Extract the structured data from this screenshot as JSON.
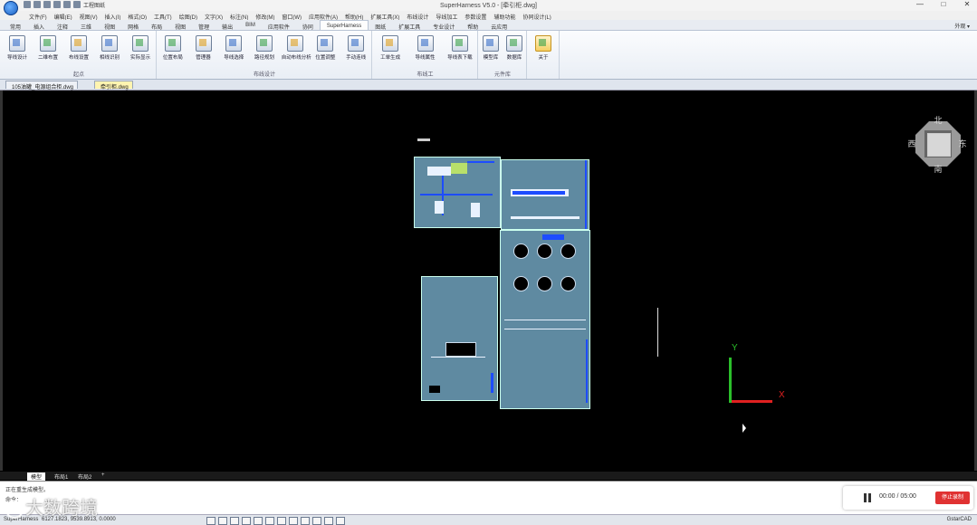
{
  "titlebar": {
    "doc_title": "SuperHarness V5.0 - [牵引柜.dwg]",
    "quick_file": "工程图纸",
    "controls": [
      "—",
      "□",
      "✕"
    ]
  },
  "menu": [
    "文件(F)",
    "编辑(E)",
    "视图(V)",
    "插入(I)",
    "格式(O)",
    "工具(T)",
    "绘图(D)",
    "文字(X)",
    "标注(N)",
    "修改(M)",
    "窗口(W)",
    "应用软件(A)",
    "帮助(H)",
    "扩展工具(X)",
    "布线设计",
    "导线加工",
    "参数设置",
    "辅助功能",
    "协同设计(L)"
  ],
  "ribbon_tabs": [
    "常用",
    "插入",
    "注释",
    "三维",
    "视图",
    "网格",
    "布局",
    "视图",
    "管理",
    "输出",
    "BIM",
    "应用软件",
    "协同",
    "SuperHarness",
    "图纸",
    "扩展工具",
    "专业设计",
    "帮助",
    "云应用"
  ],
  "ribbon_active_tab": "SuperHarness",
  "ribbon_right": "外观 ▾",
  "groups": [
    {
      "label": "起点",
      "tools": [
        "导线设计",
        "二维布置",
        "布线设置",
        "相线识别",
        "实际显示"
      ]
    },
    {
      "label": "布线设计",
      "tools": [
        "位置布局",
        "管理器",
        "导线选择",
        "路径规划",
        "自动布线分析",
        "位置调整",
        "手动连线"
      ]
    },
    {
      "label": "布线工",
      "tools": [
        "工单生成",
        "导线属性",
        "导线表下载"
      ]
    },
    {
      "label": "元件库",
      "tools": [
        "模型库",
        "数据库"
      ]
    },
    {
      "label": "",
      "tools": [
        "关于"
      ]
    }
  ],
  "doc_tabs": [
    {
      "label": "105油罐_电源组合柜.dwg",
      "active": false
    },
    {
      "label": "牵引柜.dwg",
      "active": true
    }
  ],
  "layout_tabs": [
    "模型",
    "布局1",
    "布局2",
    "+"
  ],
  "command": {
    "history": "正在重生成模型。",
    "prompt": "命令："
  },
  "player": {
    "time": "00:00 / 05:00",
    "stop_label": "停止录制"
  },
  "status": {
    "app": "SuperHarness",
    "coords": "6127.1823, 9539.8913, 0.0000",
    "cad": "GstarCAD"
  },
  "viewcube": {
    "north": "北",
    "south": "南",
    "east": "东",
    "west": "西"
  },
  "ucs": {
    "x_label": "X",
    "y_label": "Y"
  },
  "watermark": "大数跨境",
  "colors": {
    "panel": "#5f8aa1",
    "wire": "#1d4cff",
    "ribbon": "#e9eef5",
    "accent_stop": "#e03232"
  }
}
